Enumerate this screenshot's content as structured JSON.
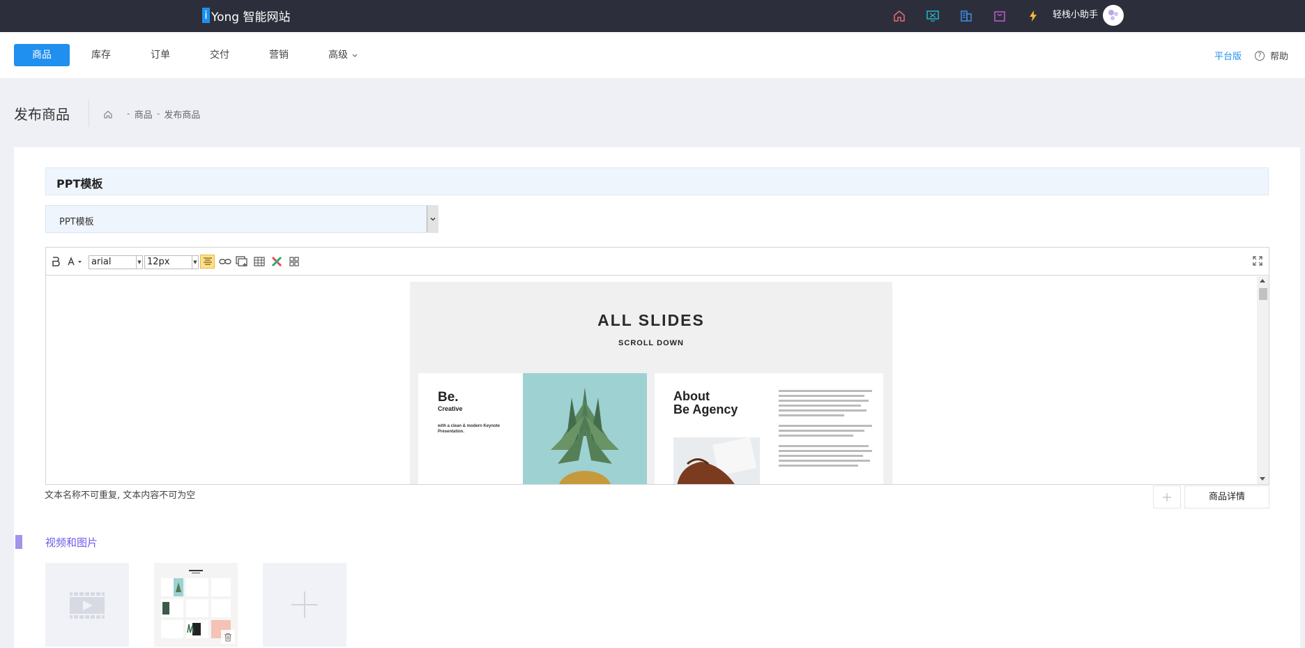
{
  "brand": {
    "logo_letter": "i",
    "name": "Yong 智能网站"
  },
  "topbar": {
    "icons": [
      "home-icon",
      "screen-icon",
      "building-icon",
      "bag-icon",
      "bolt-icon"
    ],
    "assistant_label": "轻栈小助手",
    "icon_colors": {
      "home": "#e86a73",
      "screen": "#23b7c8",
      "building": "#3d8fe8",
      "bag": "#c45ad3",
      "bolt": "#f5b82e"
    }
  },
  "nav": {
    "items": [
      {
        "label": "商品",
        "active": true
      },
      {
        "label": "库存"
      },
      {
        "label": "订单"
      },
      {
        "label": "交付"
      },
      {
        "label": "营销"
      },
      {
        "label": "高级"
      }
    ],
    "platform_label": "平台版",
    "help_label": "帮助"
  },
  "page": {
    "title": "发布商品",
    "breadcrumb": [
      "商品",
      "发布商品"
    ]
  },
  "form": {
    "section_title": "PPT模板",
    "select_value": "PPT模板",
    "editor": {
      "font_family": "arial",
      "font_size": "12px"
    },
    "hint": "文本名称不可重复, 文本内容不可为空",
    "detail_button": "商品详情"
  },
  "slide_preview": {
    "title": "ALL SLIDES",
    "subtitle": "SCROLL DOWN",
    "left_heading": "Be.",
    "left_sub": "Creative",
    "left_tagline": "with a clean & modern Keynote Presentation.",
    "right_heading_1": "About",
    "right_heading_2": "Be Agency"
  },
  "media": {
    "section_title": "视频和图片",
    "accent": "#6c5ce7"
  },
  "colors": {
    "primary": "#1f8ff0",
    "topbar": "#2c2f3b"
  }
}
